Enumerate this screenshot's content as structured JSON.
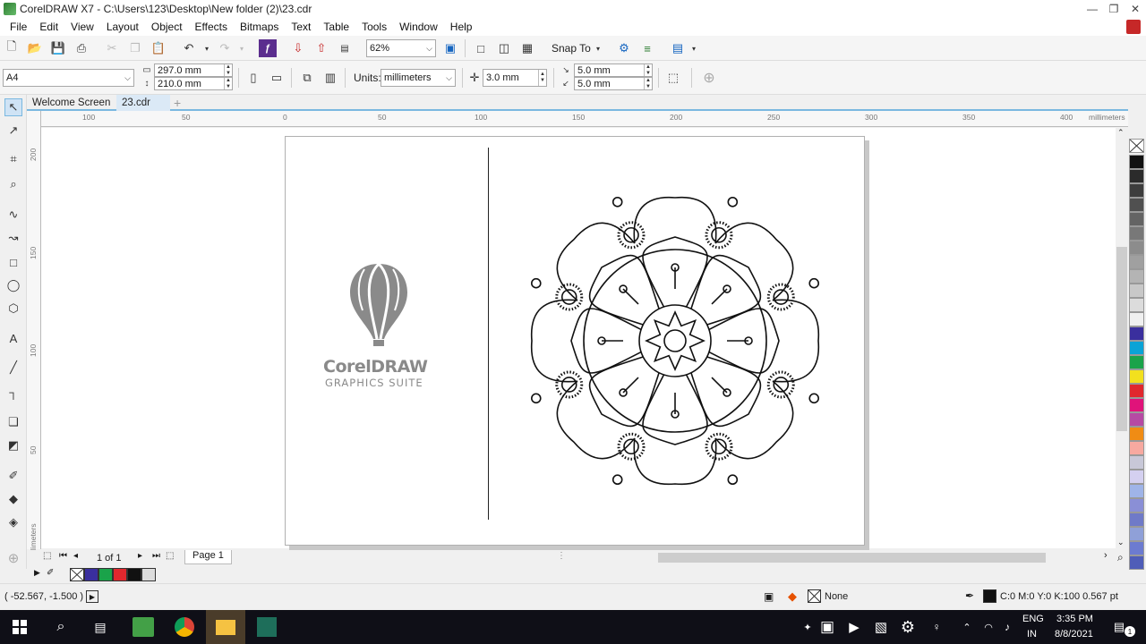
{
  "window": {
    "title": "CorelDRAW X7 - C:\\Users\\123\\Desktop\\New folder (2)\\23.cdr",
    "controls": [
      "—",
      "❐",
      "✕"
    ]
  },
  "menu": [
    "File",
    "Edit",
    "View",
    "Layout",
    "Object",
    "Effects",
    "Bitmaps",
    "Text",
    "Table",
    "Tools",
    "Window",
    "Help"
  ],
  "standard_toolbar": {
    "zoom": "62%",
    "snap_to": "Snap To"
  },
  "property_bar": {
    "page_size": "A4",
    "width": "297.0 mm",
    "height": "210.0 mm",
    "units_label": "Units:",
    "units": "millimeters",
    "nudge": "3.0 mm",
    "dup_x": "5.0 mm",
    "dup_y": "5.0 mm"
  },
  "tabs": [
    "Welcome Screen",
    "23.cdr"
  ],
  "hruler": {
    "labels": [
      "100",
      "50",
      "0",
      "50",
      "100",
      "150",
      "200",
      "250",
      "300",
      "350",
      "400"
    ],
    "unit": "millimeters"
  },
  "vruler": {
    "labels": [
      "200",
      "150",
      "100",
      "50"
    ],
    "unit": "millimeters"
  },
  "page_nav": {
    "count": "1 of 1",
    "page_tab": "Page 1"
  },
  "palette_colors": [
    "#111111",
    "#2b2b2b",
    "#3d3d3d",
    "#505050",
    "#646464",
    "#787878",
    "#8c8c8c",
    "#a0a0a0",
    "#b4b4b4",
    "#c8c8c8",
    "#dcdcdc",
    "#f0f0f0",
    "#3a2f9e",
    "#0aa3d6",
    "#1aa34a",
    "#f2e01e",
    "#e0282e",
    "#e0137a",
    "#b64aa4",
    "#f08c14",
    "#f7a9a0",
    "#c8c8d8",
    "#d4d0f0",
    "#9fb4e8",
    "#8a8fd6",
    "#6f7ac8",
    "#8fa0d8",
    "#6c7bd0",
    "#4f5db8"
  ],
  "doc_palette": [
    "#3a2f9e",
    "#1aa34a",
    "#e0282e",
    "#111111",
    "#dcdcdc"
  ],
  "status": {
    "coords": "( -52.567, -1.500 )",
    "fill": "None",
    "outline": "C:0 M:0 Y:0 K:100  0.567 pt"
  },
  "logo": {
    "name": "CorelDRAW",
    "tagline": "GRAPHICS SUITE"
  },
  "taskbar": {
    "lang_line1": "ENG",
    "lang_line2": "IN",
    "time": "3:35 PM",
    "date": "8/8/2021",
    "notifications": "1"
  }
}
